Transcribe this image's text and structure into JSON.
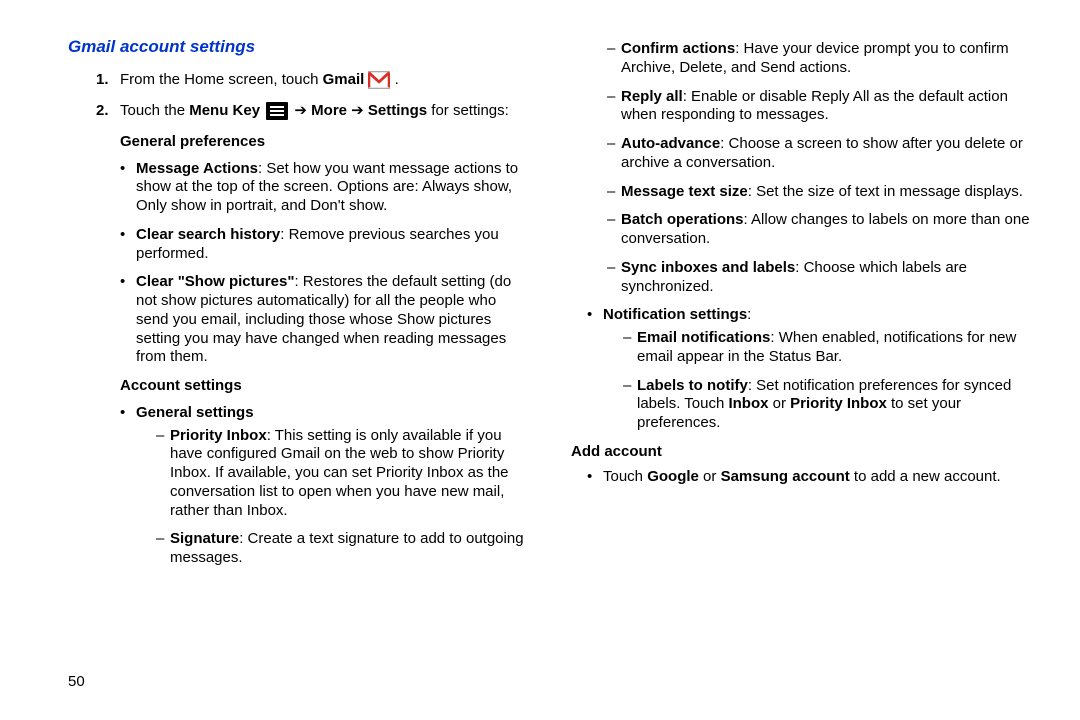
{
  "title": "Gmail account settings",
  "step1_a": "From the Home screen, touch ",
  "step1_b": "Gmail",
  "step2_a": "Touch the ",
  "step2_b": "Menu Key",
  "step2_c": "More",
  "step2_d": "Settings",
  "step2_e": " for settings:",
  "arrow": " ➔ ",
  "gen_pref": "General preferences",
  "msg_actions_b": "Message Actions",
  "msg_actions_t": ": Set how you want message actions to show at the top of the screen. Options are: Always show, Only show in portrait, and Don't show.",
  "clear_hist_b": "Clear search history",
  "clear_hist_t": ": Remove previous searches you performed.",
  "clear_pics_b": "Clear \"Show pictures\"",
  "clear_pics_t": ": Restores the default setting (do not show pictures automatically) for all the people who send you email, including those whose Show pictures setting you may have changed when reading messages from them.",
  "acct": "Account settings",
  "gen_set": "General settings",
  "priority_b": "Priority Inbox",
  "priority_t": ": This setting is only available if you have configured Gmail on the web to show Priority Inbox. If available, you can set Priority Inbox as the conversation list to open when you have new mail, rather than Inbox.",
  "sig_b": "Signature",
  "sig_t": ": Create a text signature to add to outgoing messages.",
  "confirm_b": "Confirm actions",
  "confirm_t": ": Have your device prompt you to confirm Archive, Delete, and Send actions.",
  "reply_b": "Reply all",
  "reply_t": ": Enable or disable Reply All as the default action when responding to messages.",
  "auto_b": "Auto-advance",
  "auto_t": ": Choose a screen to show after you delete or archive a conversation.",
  "mts_b": "Message text size",
  "mts_t": ": Set the size of text in message displays.",
  "batch_b": "Batch operations",
  "batch_t": ": Allow changes to labels on more than one conversation.",
  "sync_b": "Sync inboxes and labels",
  "sync_t": ": Choose which labels are synchronized.",
  "notif": "Notification settings",
  "email_b": "Email notifications",
  "email_t": ": When enabled, notifications for new email appear in the Status Bar.",
  "labels_b": "Labels to notify",
  "labels_t1": ": Set notification preferences for synced labels. Touch ",
  "labels_t2": "Inbox",
  "labels_t3": " or ",
  "labels_t4": "Priority Inbox",
  "labels_t5": " to set your preferences.",
  "add": "Add account",
  "addline_a": "Touch ",
  "addline_b": "Google",
  "addline_c": " or ",
  "addline_d": "Samsung account",
  "addline_e": " to add a new account.",
  "pagenum": "50"
}
